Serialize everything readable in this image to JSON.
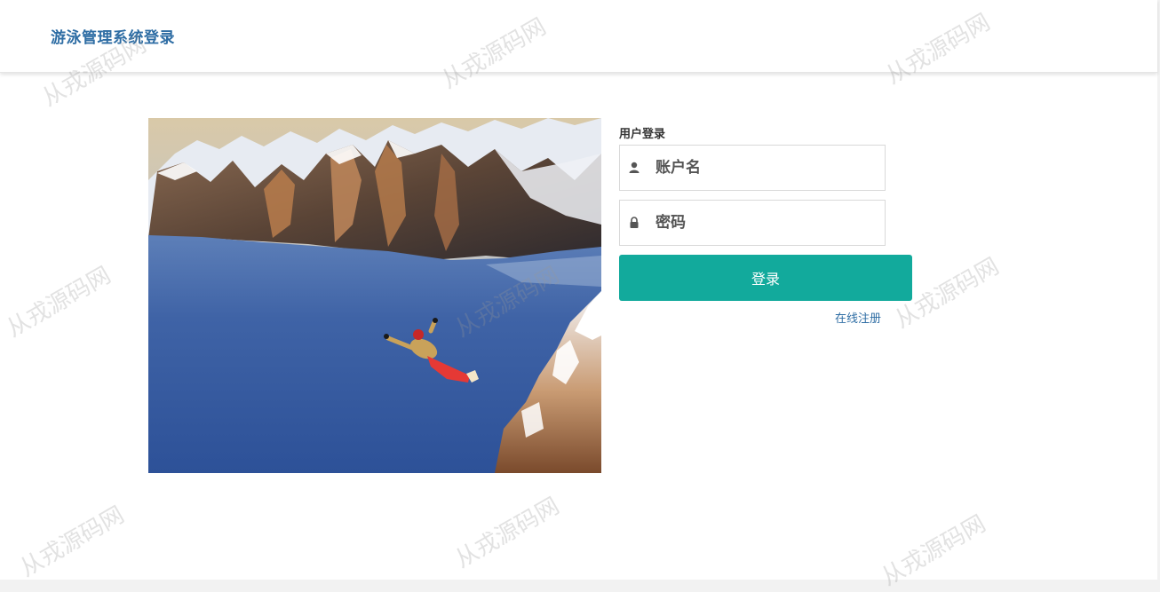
{
  "header": {
    "title": "游泳管理系统登录"
  },
  "login": {
    "title": "用户登录",
    "username_placeholder": "账户名",
    "password_placeholder": "密码",
    "submit_label": "登录",
    "register_label": "在线注册"
  },
  "hero_image": {
    "subject": "skydiver jumping from snowy cliff above lake"
  },
  "icons": {
    "username": "user-icon",
    "password": "lock-icon"
  },
  "watermark": {
    "text": "从戎源码网"
  },
  "colors": {
    "brand_title": "#2e6da4",
    "button_bg": "#12aa9c",
    "link": "#2e6da4",
    "field_border": "#d9d9d9"
  }
}
